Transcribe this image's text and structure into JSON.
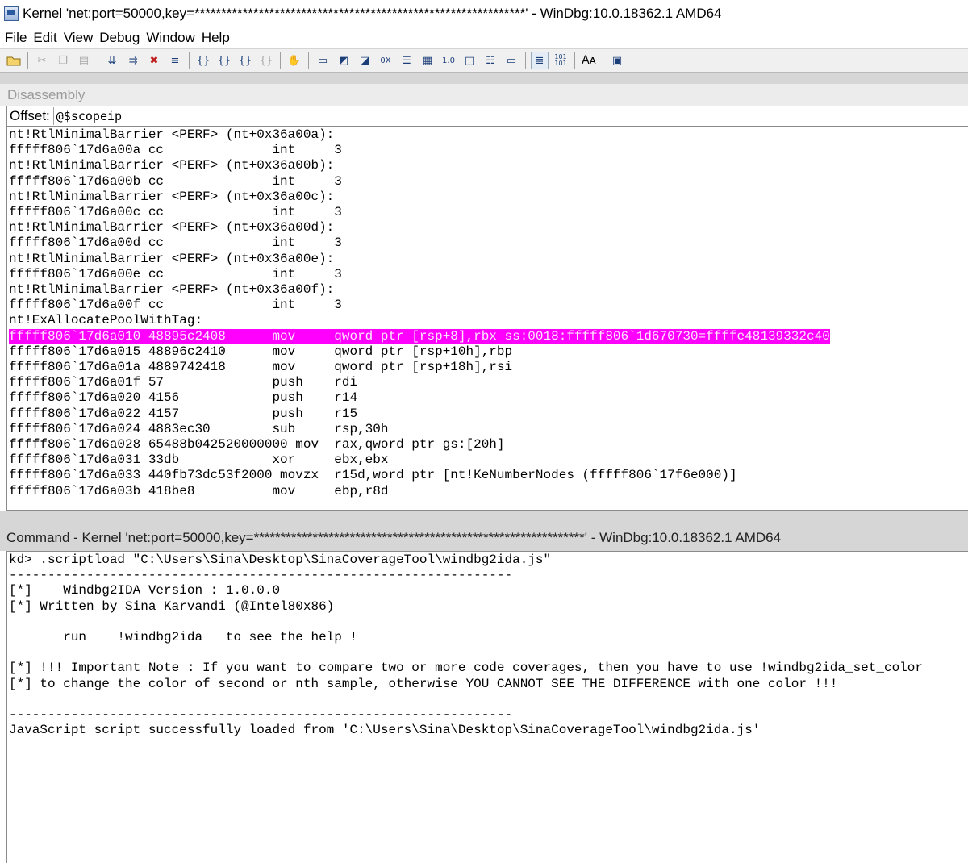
{
  "window": {
    "title": "Kernel 'net:port=50000,key=**************************************************************' - WinDbg:10.0.18362.1 AMD64"
  },
  "menu": [
    "File",
    "Edit",
    "View",
    "Debug",
    "Window",
    "Help"
  ],
  "toolbar": {
    "icons": [
      "open-folder-icon",
      "cut-icon",
      "copy-icon",
      "paste-icon",
      "step-into-icon",
      "step-over-icon",
      "break-icon",
      "run-to-cursor-icon",
      "go-icon",
      "step-out-icon",
      "restart-icon",
      "step-back-icon",
      "hand-icon",
      "command-icon",
      "watch-icon",
      "locals-icon",
      "registers-icon",
      "memory-icon",
      "call-stack-icon",
      "disassembly-icon",
      "scratch-pad-icon",
      "processes-icon",
      "source-mode-icon",
      "hex-icon",
      "font-icon",
      "options-icon"
    ]
  },
  "disassembly": {
    "title": "Disassembly",
    "offset_label": "Offset:",
    "offset_value": "@$scopeip",
    "lines": [
      "nt!RtlMinimalBarrier <PERF> (nt+0x36a00a):",
      "fffff806`17d6a00a cc              int     3",
      "nt!RtlMinimalBarrier <PERF> (nt+0x36a00b):",
      "fffff806`17d6a00b cc              int     3",
      "nt!RtlMinimalBarrier <PERF> (nt+0x36a00c):",
      "fffff806`17d6a00c cc              int     3",
      "nt!RtlMinimalBarrier <PERF> (nt+0x36a00d):",
      "fffff806`17d6a00d cc              int     3",
      "nt!RtlMinimalBarrier <PERF> (nt+0x36a00e):",
      "fffff806`17d6a00e cc              int     3",
      "nt!RtlMinimalBarrier <PERF> (nt+0x36a00f):",
      "fffff806`17d6a00f cc              int     3",
      "nt!ExAllocatePoolWithTag:",
      "fffff806`17d6a010 48895c2408      mov     qword ptr [rsp+8],rbx ss:0018:fffff806`1d670730=ffffe48139332c40",
      "fffff806`17d6a015 48896c2410      mov     qword ptr [rsp+10h],rbp",
      "fffff806`17d6a01a 4889742418      mov     qword ptr [rsp+18h],rsi",
      "fffff806`17d6a01f 57              push    rdi",
      "fffff806`17d6a020 4156            push    r14",
      "fffff806`17d6a022 4157            push    r15",
      "fffff806`17d6a024 4883ec30        sub     rsp,30h",
      "fffff806`17d6a028 65488b042520000000 mov  rax,qword ptr gs:[20h]",
      "fffff806`17d6a031 33db            xor     ebx,ebx",
      "fffff806`17d6a033 440fb73dc53f2000 movzx  r15d,word ptr [nt!KeNumberNodes (fffff806`17f6e000)]",
      "fffff806`17d6a03b 418be8          mov     ebp,r8d"
    ],
    "highlight_index": 13
  },
  "command": {
    "title": "Command - Kernel 'net:port=50000,key=**************************************************************' - WinDbg:10.0.18362.1 AMD64",
    "lines": [
      "kd> .scriptload \"C:\\Users\\Sina\\Desktop\\SinaCoverageTool\\windbg2ida.js\"",
      "-----------------------------------------------------------------",
      "[*]    Windbg2IDA Version : 1.0.0.0",
      "[*] Written by Sina Karvandi (@Intel80x86)",
      "",
      "       run    !windbg2ida   to see the help !",
      "",
      "[*] !!! Important Note : If you want to compare two or more code coverages, then you have to use !windbg2ida_set_color",
      "[*] to change the color of second or nth sample, otherwise YOU CANNOT SEE THE DIFFERENCE with one color !!!",
      "",
      "-----------------------------------------------------------------",
      "JavaScript script successfully loaded from 'C:\\Users\\Sina\\Desktop\\SinaCoverageTool\\windbg2ida.js'"
    ]
  },
  "colors": {
    "highlight": "#ff00ff",
    "highlight_text": "#ffe6ff"
  }
}
